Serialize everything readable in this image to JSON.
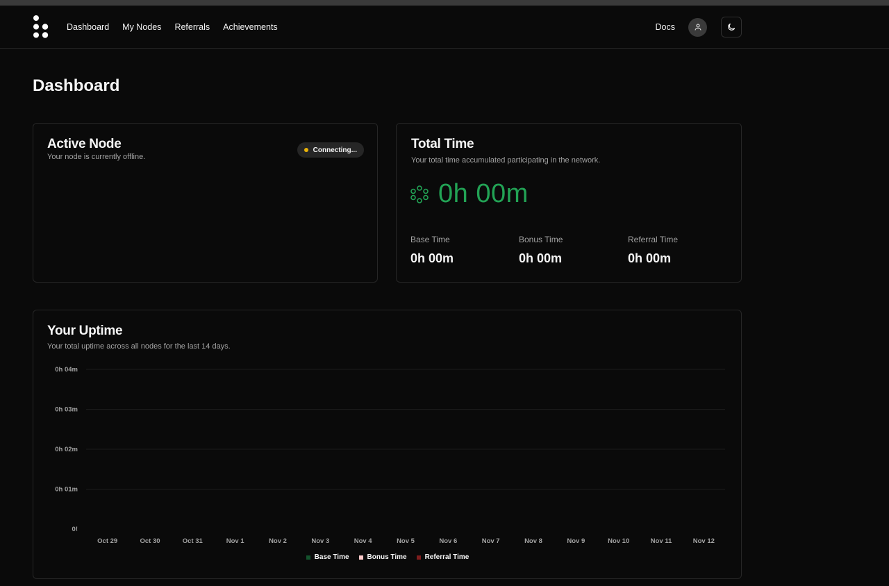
{
  "nav": {
    "links": [
      "Dashboard",
      "My Nodes",
      "Referrals",
      "Achievements"
    ],
    "docs": "Docs"
  },
  "page_title": "Dashboard",
  "active_node": {
    "title": "Active Node",
    "subtitle": "Your node is currently offline.",
    "status": "Connecting...",
    "status_color": "#eab308"
  },
  "total_time": {
    "title": "Total Time",
    "subtitle": "Your total time accumulated participating in the network.",
    "value": "0h 00m",
    "accent": "#22a355",
    "stats": [
      {
        "label": "Base Time",
        "value": "0h 00m"
      },
      {
        "label": "Bonus Time",
        "value": "0h 00m"
      },
      {
        "label": "Referral Time",
        "value": "0h 00m"
      }
    ]
  },
  "uptime": {
    "title": "Your Uptime",
    "subtitle": "Your total uptime across all nodes for the last 14 days."
  },
  "chart_data": {
    "type": "bar",
    "title": "",
    "xlabel": "",
    "ylabel": "",
    "y_ticks": [
      "0h 04m",
      "0h 03m",
      "0h 02m",
      "0h 01m",
      "0!"
    ],
    "categories": [
      "Oct 29",
      "Oct 30",
      "Oct 31",
      "Nov 1",
      "Nov 2",
      "Nov 3",
      "Nov 4",
      "Nov 5",
      "Nov 6",
      "Nov 7",
      "Nov 8",
      "Nov 9",
      "Nov 10",
      "Nov 11",
      "Nov 12"
    ],
    "series": [
      {
        "name": "Base Time",
        "color": "#14532d",
        "values": [
          0,
          0,
          0,
          0,
          0,
          0,
          0,
          0,
          0,
          0,
          0,
          0,
          0,
          0,
          0
        ]
      },
      {
        "name": "Bonus Time",
        "color": "#fecaca",
        "values": [
          0,
          0,
          0,
          0,
          0,
          0,
          0,
          0,
          0,
          0,
          0,
          0,
          0,
          0,
          0
        ]
      },
      {
        "name": "Referral Time",
        "color": "#7f1d1d",
        "values": [
          0,
          0,
          0,
          0,
          0,
          0,
          0,
          0,
          0,
          0,
          0,
          0,
          0,
          0,
          0
        ]
      }
    ],
    "ylim": [
      0,
      4
    ],
    "grid": true,
    "legend": "bottom"
  }
}
